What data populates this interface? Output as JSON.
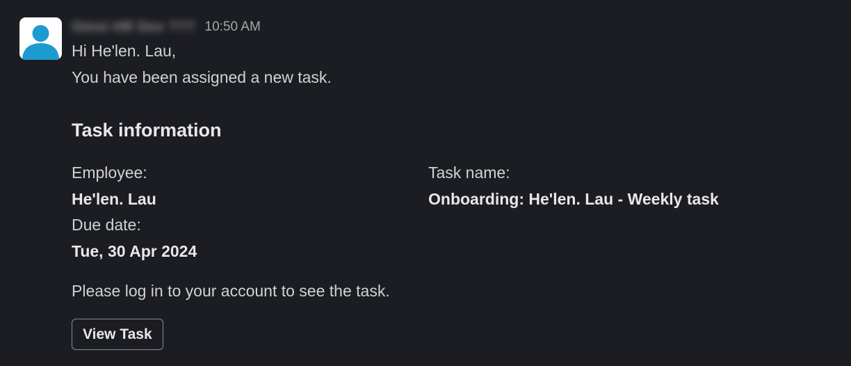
{
  "message": {
    "sender_name": "Omni HR Dev ???",
    "timestamp": "10:50 AM",
    "greeting": "Hi He'len. Lau,",
    "intro": "You have been assigned a new task.",
    "section_title": "Task information",
    "fields": {
      "employee_label": "Employee:",
      "employee_value": "He'len. Lau",
      "task_name_label": "Task name:",
      "task_name_value": "Onboarding: He'len. Lau - Weekly task",
      "due_date_label": "Due date:",
      "due_date_value": "Tue, 30 Apr 2024"
    },
    "footer_note": "Please log in to your account to see the task.",
    "button_label": "View Task"
  },
  "avatar": {
    "icon": "user-icon",
    "color": "#1d9bd1"
  }
}
